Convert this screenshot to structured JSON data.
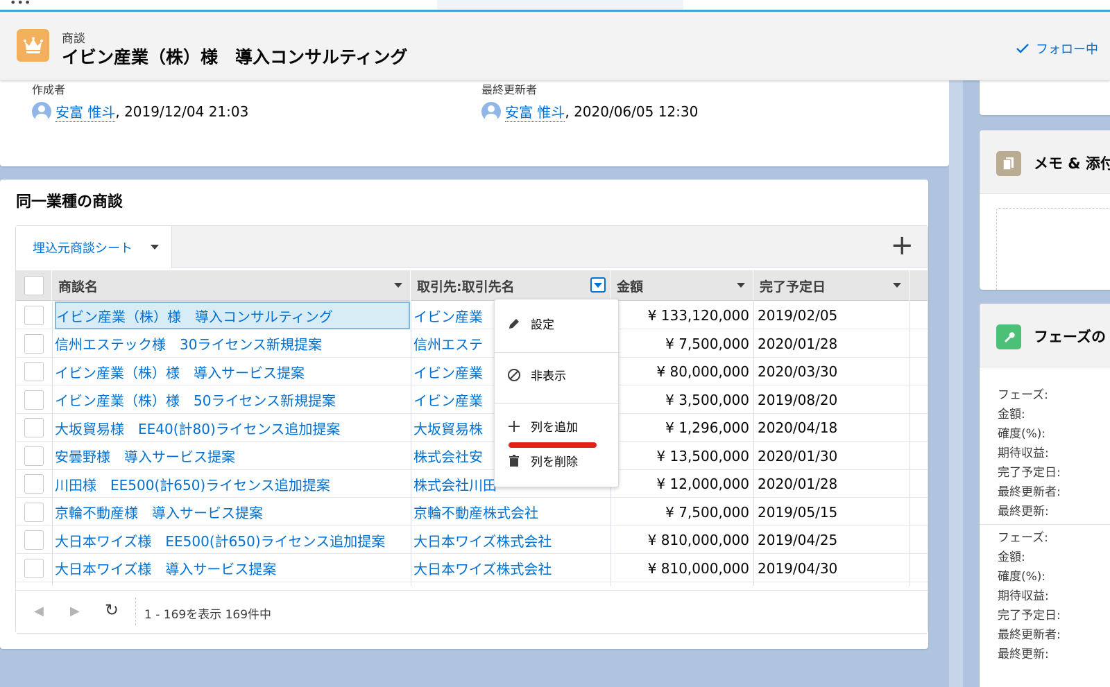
{
  "header": {
    "object_type": "商談",
    "title": "イビン産業（株）様　導入コンサルティング",
    "follow_label": "フォロー中"
  },
  "info": {
    "created_by_label": "作成者",
    "created_by_user": "安富 惟斗",
    "created_by_date": ", 2019/12/04 21:03",
    "modified_by_label": "最終更新者",
    "modified_by_user": "安富 惟斗",
    "modified_by_date": ", 2020/06/05 12:30"
  },
  "section": {
    "title": "同一業種の商談",
    "sheet_tab": "埋込元商談シート"
  },
  "grid": {
    "columns": [
      "商談名",
      "取引先:取引先名",
      "金額",
      "完了予定日"
    ],
    "rows": [
      {
        "name": "イビン産業（株）様　導入コンサルティング",
        "account": "イビン産業",
        "amount": "¥ 133,120,000",
        "date": "2019/02/05"
      },
      {
        "name": "信州エステック様　30ライセンス新規提案",
        "account": "信州エステ",
        "amount": "¥ 7,500,000",
        "date": "2020/01/28"
      },
      {
        "name": "イビン産業（株）様　導入サービス提案",
        "account": "イビン産業",
        "amount": "¥ 80,000,000",
        "date": "2020/03/30"
      },
      {
        "name": "イビン産業（株）様　50ライセンス新規提案",
        "account": "イビン産業",
        "amount": "¥ 3,500,000",
        "date": "2019/08/20"
      },
      {
        "name": "大坂貿易様　EE40(計80)ライセンス追加提案",
        "account": "大坂貿易株",
        "amount": "¥ 1,296,000",
        "date": "2020/04/18"
      },
      {
        "name": "安曇野様　導入サービス提案",
        "account": "株式会社安",
        "amount": "¥ 13,500,000",
        "date": "2020/01/30"
      },
      {
        "name": "川田様　EE500(計650)ライセンス追加提案",
        "account": "株式会社川田",
        "amount": "¥ 12,000,000",
        "date": "2020/01/28"
      },
      {
        "name": "京輪不動産様　導入サービス提案",
        "account": "京輪不動産株式会社",
        "amount": "¥ 7,500,000",
        "date": "2019/05/15"
      },
      {
        "name": "大日本ワイズ様　EE500(計650)ライセンス追加提案",
        "account": "大日本ワイズ株式会社",
        "amount": "¥ 810,000,000",
        "date": "2019/04/25"
      },
      {
        "name": "大日本ワイズ様　導入サービス提案",
        "account": "大日本ワイズ株式会社",
        "amount": "¥ 810,000,000",
        "date": "2019/04/30"
      }
    ],
    "footer_count": "1 - 169を表示 169件中"
  },
  "menu": {
    "settings": "設定",
    "hide": "非表示",
    "add_column": "列を追加",
    "delete_column": "列を削除"
  },
  "right": {
    "notes_title": "メモ & 添付",
    "phase_title": "フェーズの",
    "phase_fields": [
      "フェーズ:",
      "金額:",
      "確度(%):",
      "期待収益:",
      "完了予定日:",
      "最終更新者:",
      "最終更新:"
    ]
  },
  "colors": {
    "link": "#0070d2",
    "accent_line": "#e0231a",
    "object_icon": "#f2b05d"
  }
}
